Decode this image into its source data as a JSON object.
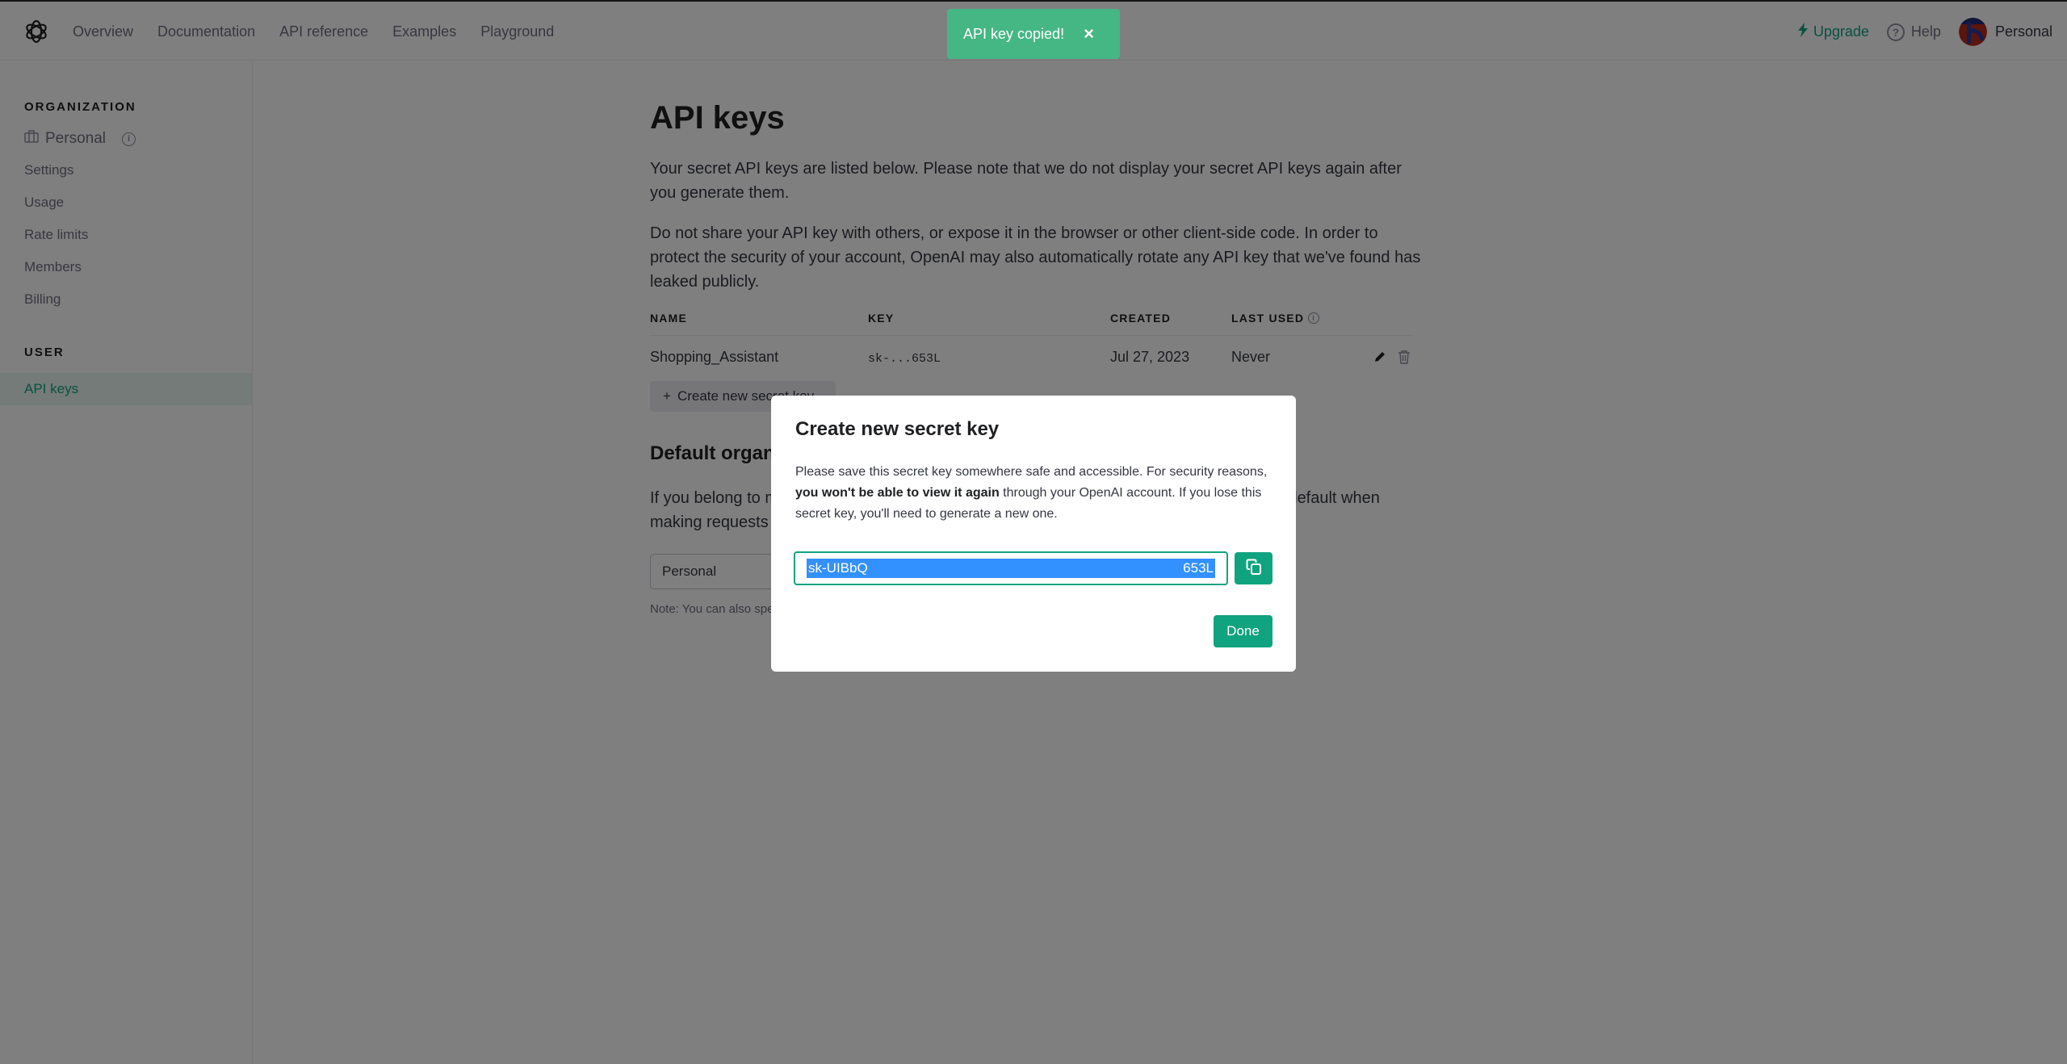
{
  "nav": {
    "logo": "openai-logo",
    "links": [
      "Overview",
      "Documentation",
      "API reference",
      "Examples",
      "Playground"
    ],
    "upgrade": "Upgrade",
    "help": "Help",
    "help_glyph": "?",
    "account": "Personal"
  },
  "sidebar": {
    "org_heading": "ORGANIZATION",
    "org_name": "Personal",
    "info_glyph": "i",
    "org_items": [
      "Settings",
      "Usage",
      "Rate limits",
      "Members",
      "Billing"
    ],
    "user_heading": "USER",
    "user_items": [
      {
        "label": "API keys",
        "active": true
      }
    ]
  },
  "main": {
    "title": "API keys",
    "intro": "Your secret API keys are listed below. Please note that we do not display your secret API keys again after you generate them.",
    "warning": "Do not share your API key with others, or expose it in the browser or other client-side code. In order to protect the security of your account, OpenAI may also automatically rotate any API key that we've found has leaked publicly.",
    "table": {
      "headers": [
        "NAME",
        "KEY",
        "CREATED",
        "LAST USED"
      ],
      "rows": [
        {
          "name": "Shopping_Assistant",
          "key": "sk-...653L",
          "created": "Jul 27, 2023",
          "last_used": "Never"
        }
      ]
    },
    "create_button": "Create new secret key",
    "create_plus": "+",
    "default_org_title": "Default organization",
    "default_org_text": "If you belong to multiple organizations, this setting controls which organization is used by default when making requests with the API keys above.",
    "org_select_value": "Personal",
    "note": "Note: You can also specify which organization to use for each API request. See Authentication to learn more."
  },
  "toast": {
    "message": "API key copied!",
    "close": "×",
    "color": "#45b784"
  },
  "modal": {
    "title": "Create new secret key",
    "text_before": "Please save this secret key somewhere safe and accessible. For security reasons, ",
    "text_bold": "you won't be able to view it again",
    "text_after": " through your OpenAI account. If you lose this secret key, you'll need to generate a new one.",
    "key_prefix": "sk-UIBbQ",
    "key_suffix": "653L",
    "done": "Done",
    "accent": "#10a37f"
  }
}
